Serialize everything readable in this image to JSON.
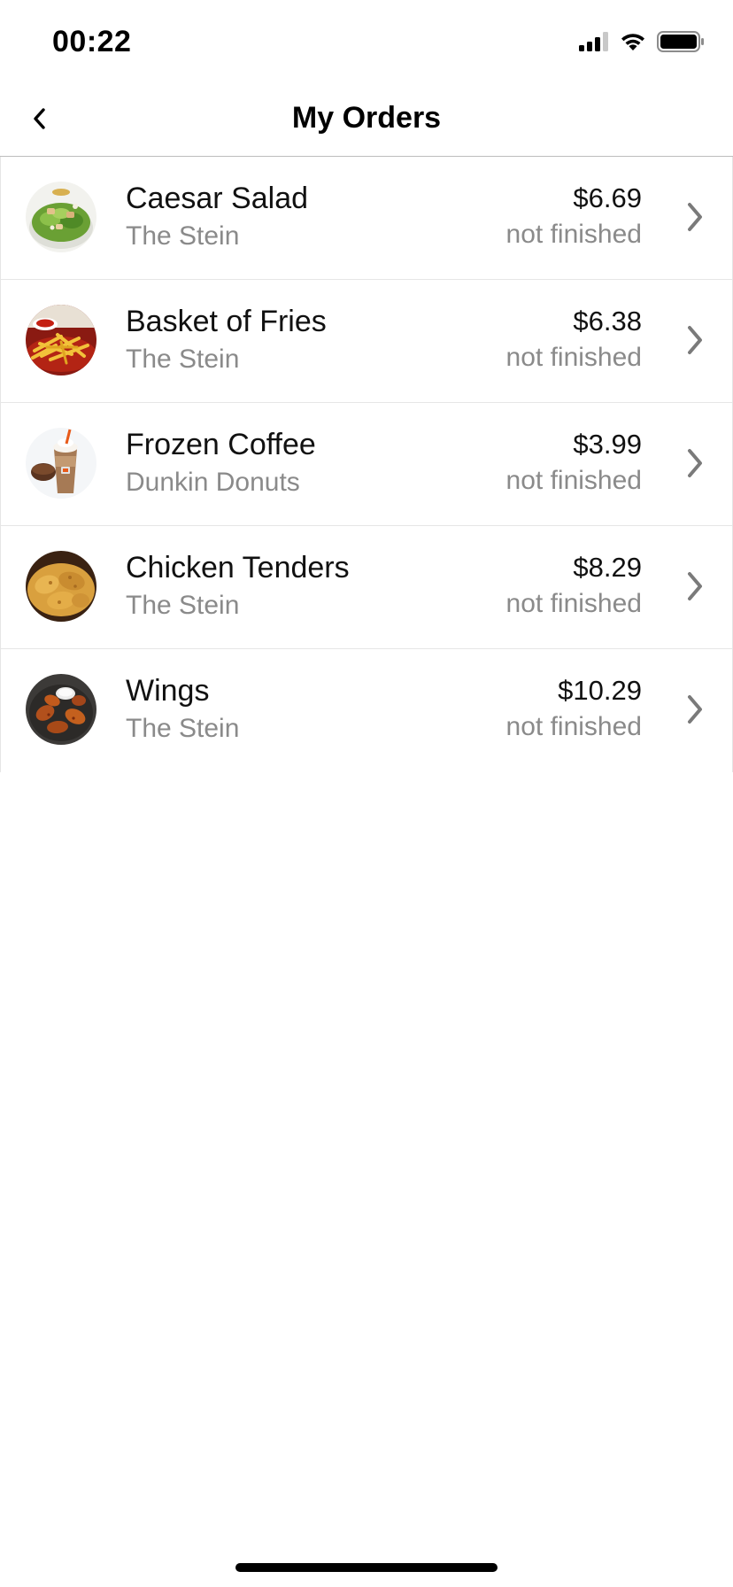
{
  "status_bar": {
    "time": "00:22",
    "icons": [
      "signal-icon",
      "wifi-icon",
      "battery-icon"
    ]
  },
  "nav": {
    "title": "My Orders",
    "back_icon": "chevron-left-icon"
  },
  "orders": [
    {
      "name": "Caesar Salad",
      "vendor": "The Stein",
      "price": "$6.69",
      "status": "not finished",
      "icon": "caesar-salad-thumbnail"
    },
    {
      "name": "Basket of Fries",
      "vendor": "The Stein",
      "price": "$6.38",
      "status": "not finished",
      "icon": "fries-thumbnail"
    },
    {
      "name": "Frozen Coffee",
      "vendor": "Dunkin Donuts",
      "price": "$3.99",
      "status": "not finished",
      "icon": "frozen-coffee-thumbnail"
    },
    {
      "name": "Chicken Tenders",
      "vendor": "The Stein",
      "price": "$8.29",
      "status": "not finished",
      "icon": "chicken-tenders-thumbnail"
    },
    {
      "name": "Wings",
      "vendor": "The Stein",
      "price": "$10.29",
      "status": "not finished",
      "icon": "wings-thumbnail"
    }
  ],
  "colors": {
    "secondary_text": "#8a8a8a",
    "chevron": "#7a7a7a",
    "divider": "#e6e6e6"
  }
}
